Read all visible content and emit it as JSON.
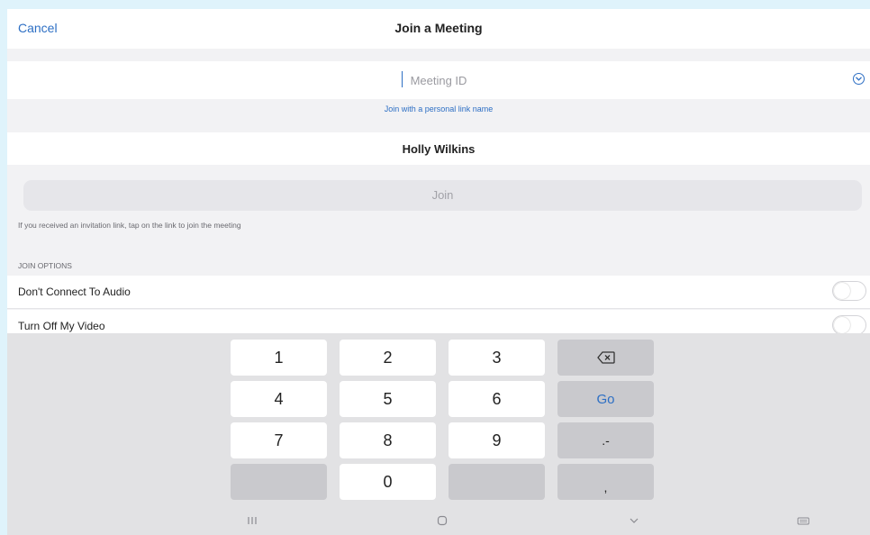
{
  "header": {
    "cancel_label": "Cancel",
    "title": "Join a Meeting"
  },
  "meeting_id": {
    "value": "",
    "placeholder": "Meeting ID"
  },
  "personal_link_label": "Join with a personal link name",
  "name_value": "Holly Wilkins",
  "join_label": "Join",
  "hint_text": "If you received an invitation link, tap on the link to join the meeting",
  "join_options": {
    "heading": "JOIN OPTIONS",
    "items": [
      {
        "label": "Don't Connect To Audio",
        "enabled": false
      },
      {
        "label": "Turn Off My Video",
        "enabled": false
      }
    ]
  },
  "keyboard": {
    "keys": [
      "1",
      "2",
      "3",
      "4",
      "5",
      "6",
      "7",
      "8",
      "9",
      "0"
    ],
    "go_label": "Go",
    "symbol_label": ".-",
    "comma_label": ","
  },
  "colors": {
    "accent": "#2d6fc4",
    "background": "#f2f2f4"
  }
}
